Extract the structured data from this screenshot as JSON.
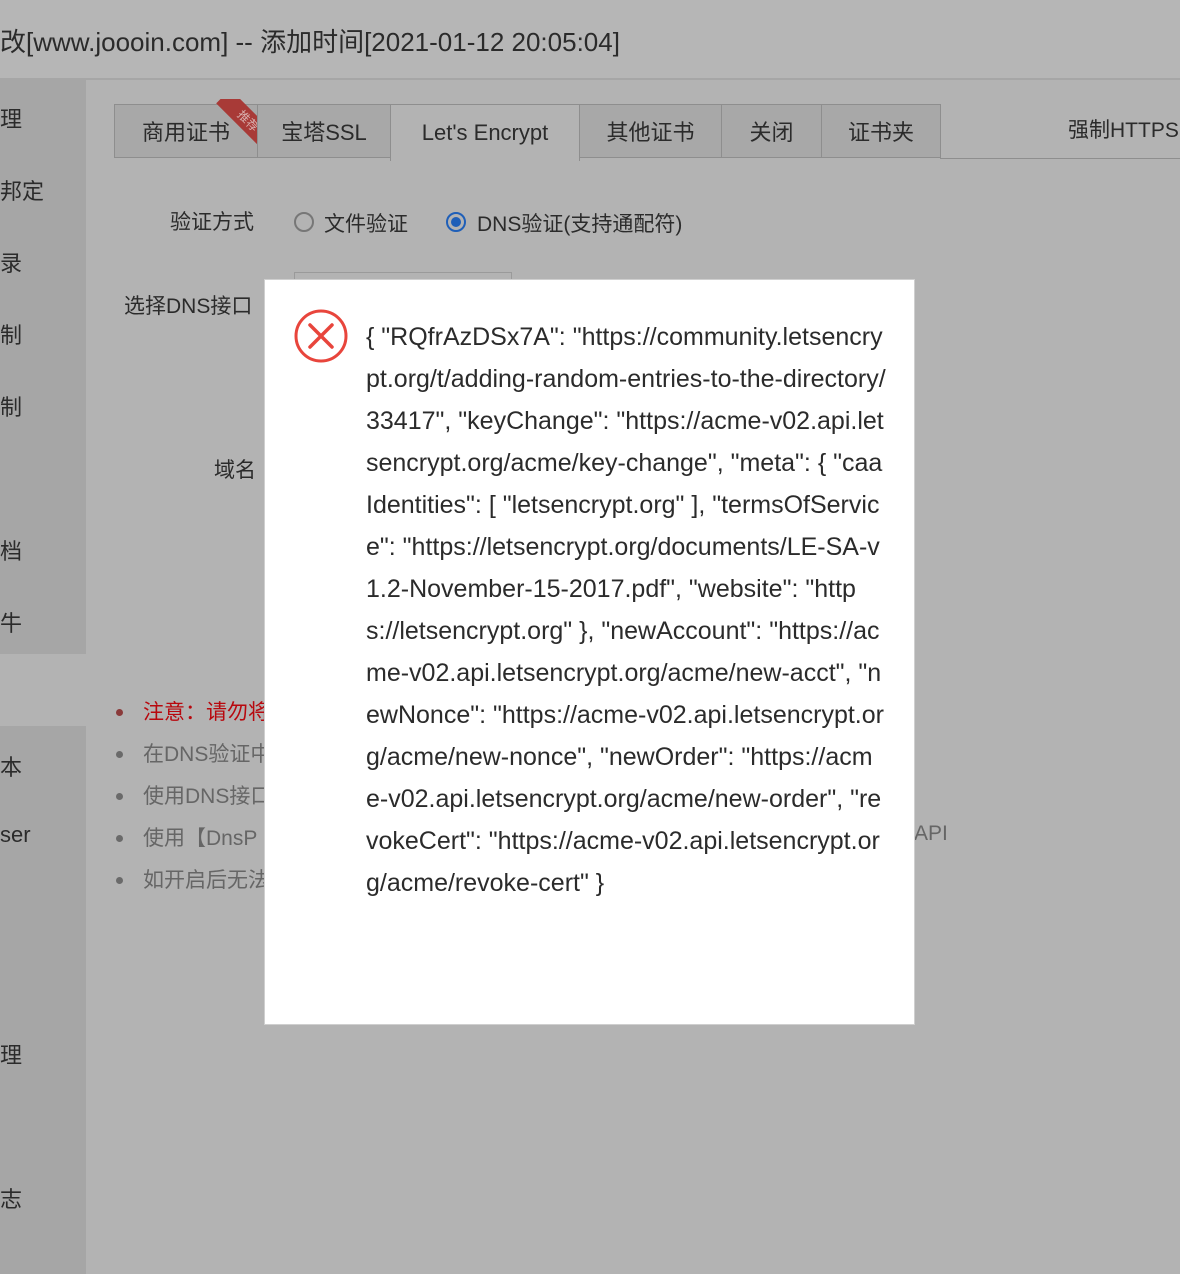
{
  "window": {
    "title": "改[www.joooin.com] -- 添加时间[2021-01-12 20:05:04]"
  },
  "sidebar": {
    "items": [
      "理",
      "邦定",
      "录",
      "制",
      "制",
      "档",
      "牛",
      "本",
      "ser",
      "",
      "理",
      "志"
    ]
  },
  "tabs": [
    {
      "label": "商用证书",
      "active": false,
      "ribbon": "推荐"
    },
    {
      "label": "宝塔SSL",
      "active": false
    },
    {
      "label": "Let's Encrypt",
      "active": true
    },
    {
      "label": "其他证书",
      "active": false
    },
    {
      "label": "关闭",
      "active": false
    },
    {
      "label": "证书夹",
      "active": false
    }
  ],
  "force_https_label": "强制HTTPS",
  "form": {
    "verify_method_label": "验证方式",
    "radio_file_label": "文件验证",
    "radio_dns_label": "DNS验证(支持通配符)",
    "selected_method": "dns",
    "dns_api_label": "选择DNS接口",
    "domain_label": "域名"
  },
  "notes": [
    {
      "text": "注意：请勿将",
      "style": "warning"
    },
    {
      "text": "在DNS验证中",
      "style": "normal"
    },
    {
      "text": "使用DNS接口",
      "style": "normal"
    },
    {
      "text": "使用【DnsP",
      "style": "normal"
    },
    {
      "text": "如开启后无法",
      "style": "normal"
    }
  ],
  "notes_trailing_text": "API",
  "modal": {
    "icon": "error-circle-icon",
    "icon_color": "#e8453c",
    "message": "{ \"RQfrAzDSx7A\": \"https://community.letsencrypt.org/t/adding-random-entries-to-the-directory/33417\", \"keyChange\": \"https://acme-v02.api.letsencrypt.org/acme/key-change\", \"meta\": { \"caaIdentities\": [ \"letsencrypt.org\" ], \"termsOfService\": \"https://letsencrypt.org/documents/LE-SA-v1.2-November-15-2017.pdf\", \"website\": \"https://letsencrypt.org\" }, \"newAccount\": \"https://acme-v02.api.letsencrypt.org/acme/new-acct\", \"newNonce\": \"https://acme-v02.api.letsencrypt.org/acme/new-nonce\", \"newOrder\": \"https://acme-v02.api.letsencrypt.org/acme/new-order\", \"revokeCert\": \"https://acme-v02.api.letsencrypt.org/acme/revoke-cert\" }"
  }
}
